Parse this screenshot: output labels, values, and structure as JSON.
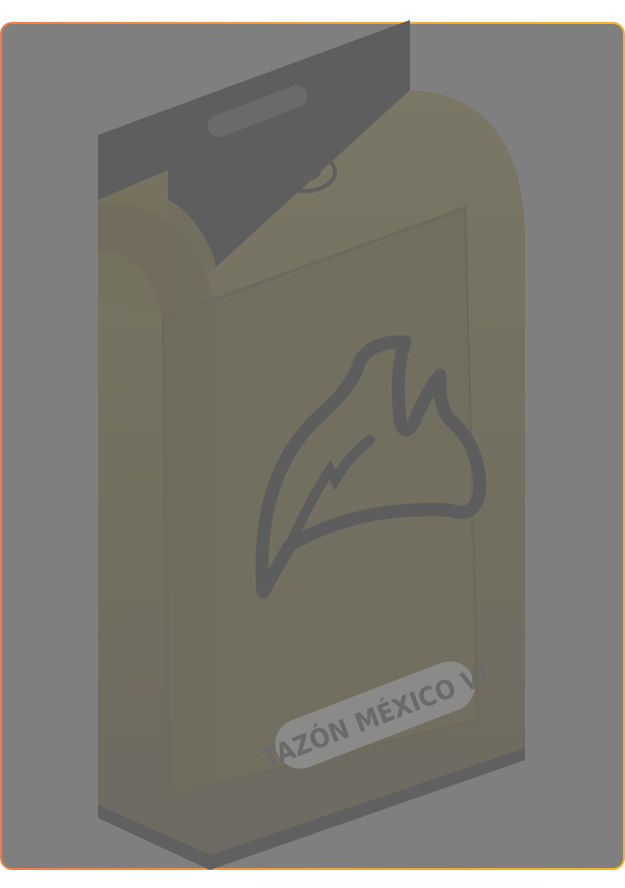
{
  "product": {
    "label": "TAZÓN MÉXICO VI",
    "icon": "flame-icon"
  },
  "colors": {
    "overlay": "#7f7f7f",
    "border_start": "#f07b48",
    "border_end": "#f5b51e",
    "box_tint": "#7a7460",
    "hanger": "#5f5f5f"
  }
}
